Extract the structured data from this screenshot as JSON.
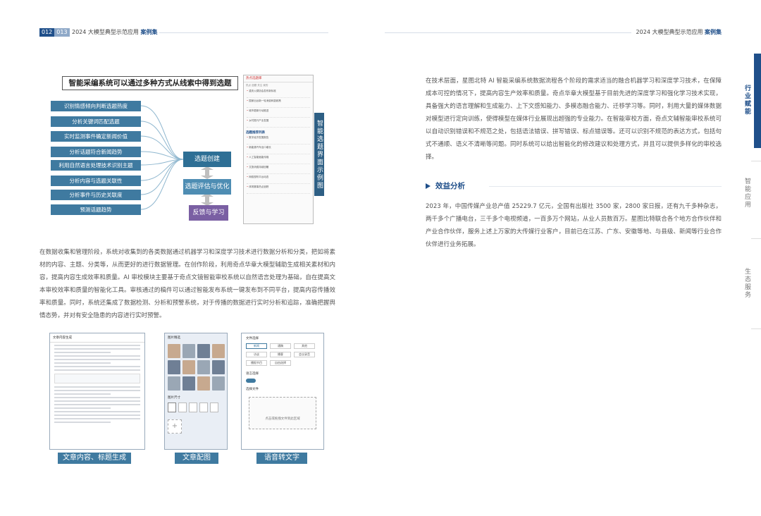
{
  "header": {
    "page_left": "012",
    "page_right": "013",
    "title_left": "2024 大模型典型示范应用",
    "title_left_em": "案例集",
    "title_right": "2024 大模型典型示范应用",
    "title_right_em": "案例集"
  },
  "side_tabs": [
    "行业赋能",
    "智能应用",
    "生态服务"
  ],
  "diagram": {
    "title": "智能采编系统可以通过多种方式从线索中得到选题",
    "features": [
      "识别情感倾向判断选题热度",
      "分析关键词匹配选题",
      "实时监测事件确定新闻价值",
      "分析话题符合新闻趋势",
      "利用自然语言处理技术识别主题",
      "分析内容与选题关联性",
      "分析事件与历史关联度",
      "预测话题趋势"
    ],
    "stages": [
      "选题创建",
      "选题评估与优化",
      "反馈与学习"
    ]
  },
  "phone": {
    "header": "热点选题库",
    "tabs": "热点  选题  关注  我的",
    "section": "选题推荐列表",
    "rows": [
      "重庆火锅协会发布新标准",
      "国家出台新一轮消费刺激政策",
      "城市更新行动推进",
      "乡村振兴产业发展",
      "数字经济发展报告",
      "新能源汽车出口增长",
      "人工智能赋能传媒",
      "文旅消费持续回暖",
      "网络视听平台动态",
      "体育赛事热点追踪"
    ]
  },
  "vertical_label": "智能选题界面示例图",
  "paragraph_left": "在数据收集和管理阶段，系统对收集到的各类数据通过机器学习和深度学习技术进行数据分析和分类，把如将素材的内容、主题、分类等，从而更好的进行数据管理。在创作阶段，利用奇点华章大模型辅助生成相关素材和内容，提高内容生成效率和质量。AI 审校模块主要基于奇点文镜智能审校系统以自然语言处理为基础，自在提高文本审校效率和质量的智能化工具。审核通过的稿件可以通过智能发布系统一键发布到不同平台，提高内容传播效率和质量。同时，系统还集成了数据检测、分析和预警系统，对于传播的数据进行实时分析和追踪，准确把握舆情态势，并对有安全隐患的内容进行实时预警。",
  "paragraph_right_1": "在技术层面，星图北特 AI 智能采编系统数据流程各个阶段的需求适当的融合机器学习和深度学习技术，在保障成本可控的情况下，提高内容生产效率和质量。奇点华章大模型基于目前先进的深度学习和强化学习技术实现，具备强大的语言理解和生成能力、上下文感知能力、多模态融合能力、迁移学习等。同时，利用大量的媒体数据对模型进行定向训练，使得模型在媒体行业展现出超强的专业能力。在智能审校方面，奇点文辅智能审校系统可以自动识别错误和不规范之处，包括语法错误、拼写错误、标点错误等。还可以识别不规范的表达方式，包括句式不通顺、语义不清晰等问题。同时系统可以给出智能化的修改建议和处理方式，并且可以提供多样化的审校选择。",
  "section_title": "效益分析",
  "paragraph_right_2": "2023 年，中国传媒产业总产值 25229.7 亿元，全国有出版社 3500 家，2800 家日报，还有九千多种杂志，两千多个广播电台，三千多个电视频道，一百多万个网站，从业人员数百万。星图比特联合各个地方合作伙伴和产业合作伙伴，服务上述上万家的大传媒行业客户，目前已在江苏、广东、安徽等地、与县级、新闻等行业合作伙伴进行业务拓展。",
  "screenshots": {
    "captions": [
      "文章内容、标题生成",
      "文章配图",
      "语音转文字"
    ],
    "shot1_title": "文章内容生成",
    "shot2_title": "图片精选",
    "shot2_section": "图片尺寸",
    "shot3_title": "文件选择",
    "shot3_chips": [
      "新闻",
      "通稿",
      "其他",
      "访谈",
      "播客",
      "会议录音",
      "播报节目",
      "自由选择"
    ],
    "shot3_section1": "语言选择",
    "shot3_section2": "选择文件",
    "shot3_upload": "点击或拖拽文件到此区域"
  },
  "colors": {
    "brand": "#1f4f8a",
    "feature": "#3f7aa0",
    "feedback": "#7a5fa3"
  }
}
